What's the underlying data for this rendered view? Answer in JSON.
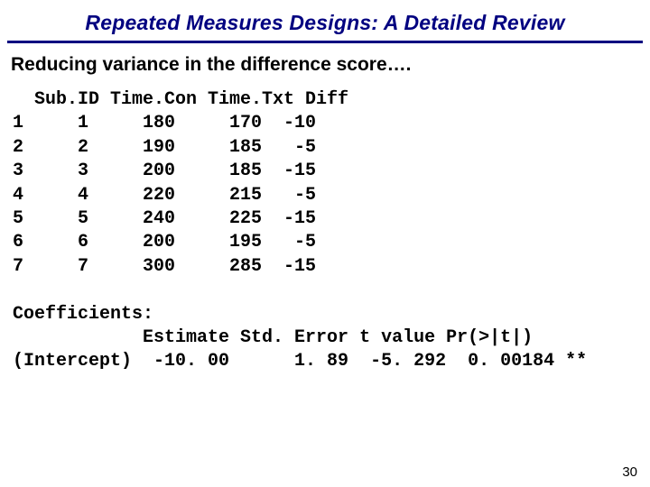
{
  "title": "Repeated Measures Designs:  A Detailed Review",
  "subtitle": "Reducing variance in the difference score….",
  "table": {
    "header": "  Sub.ID Time.Con Time.Txt Diff",
    "rows": [
      "1     1     180     170  -10",
      "2     2     190     185   -5",
      "3     3     200     185  -15",
      "4     4     220     215   -5",
      "5     5     240     225  -15",
      "6     6     200     195   -5",
      "7     7     300     285  -15"
    ]
  },
  "coef": {
    "heading": "Coefficients:",
    "header": "            Estimate Std. Error t value Pr(>|t|)",
    "row": "(Intercept)  -10. 00      1. 89  -5. 292  0. 00184 **"
  },
  "pagenum": "30"
}
